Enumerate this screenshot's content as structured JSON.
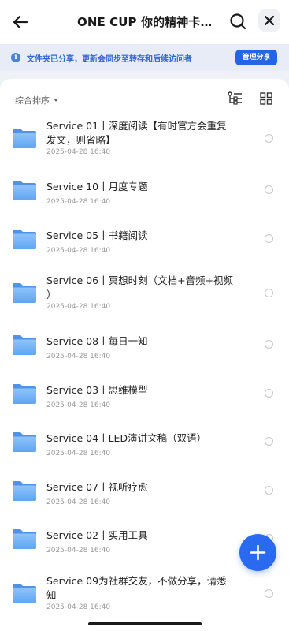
{
  "header": {
    "title": "ONE CUP 你的精神卡…"
  },
  "notice": {
    "text": "文件夹已分享，更新会同步至转存和后续访问者",
    "icon": "info-icon",
    "manage_label": "管理分享"
  },
  "toolbar": {
    "sort_label": "综合排序"
  },
  "files": [
    {
      "line1": "Service 01丨深度阅读【有时官方会重复",
      "line2": "发文，则省略】",
      "date": "2025-04-28 16:40"
    },
    {
      "line1": "Service 10丨月度专题",
      "line2": "",
      "date": "2025-04-28 16:40"
    },
    {
      "line1": "Service 05丨书籍阅读",
      "line2": "",
      "date": "2025-04-28 16:40"
    },
    {
      "line1": "Service 06丨冥想时刻（文档+音频+视频",
      "line2": "）",
      "date": "2025-04-28 16:40"
    },
    {
      "line1": "Service 08丨每日一知",
      "line2": "",
      "date": "2025-04-28 16:40"
    },
    {
      "line1": "Service 03丨思维模型",
      "line2": "",
      "date": "2025-04-28 16:40"
    },
    {
      "line1": "Service 04丨LED演讲文稿（双语）",
      "line2": "",
      "date": "2025-04-28 16:40"
    },
    {
      "line1": "Service 07丨视听疗愈",
      "line2": "",
      "date": "2025-04-28 16:40"
    },
    {
      "line1": "Service 02丨实用工具",
      "line2": "",
      "date": "2025-04-28 16:40"
    },
    {
      "line1": "Service 09为社群交友，不做分享，请悉",
      "line2": "知",
      "date": "2025-04-28 16:40"
    }
  ],
  "colors": {
    "accent": "#2364e8",
    "folder": "#5aa0f0"
  }
}
